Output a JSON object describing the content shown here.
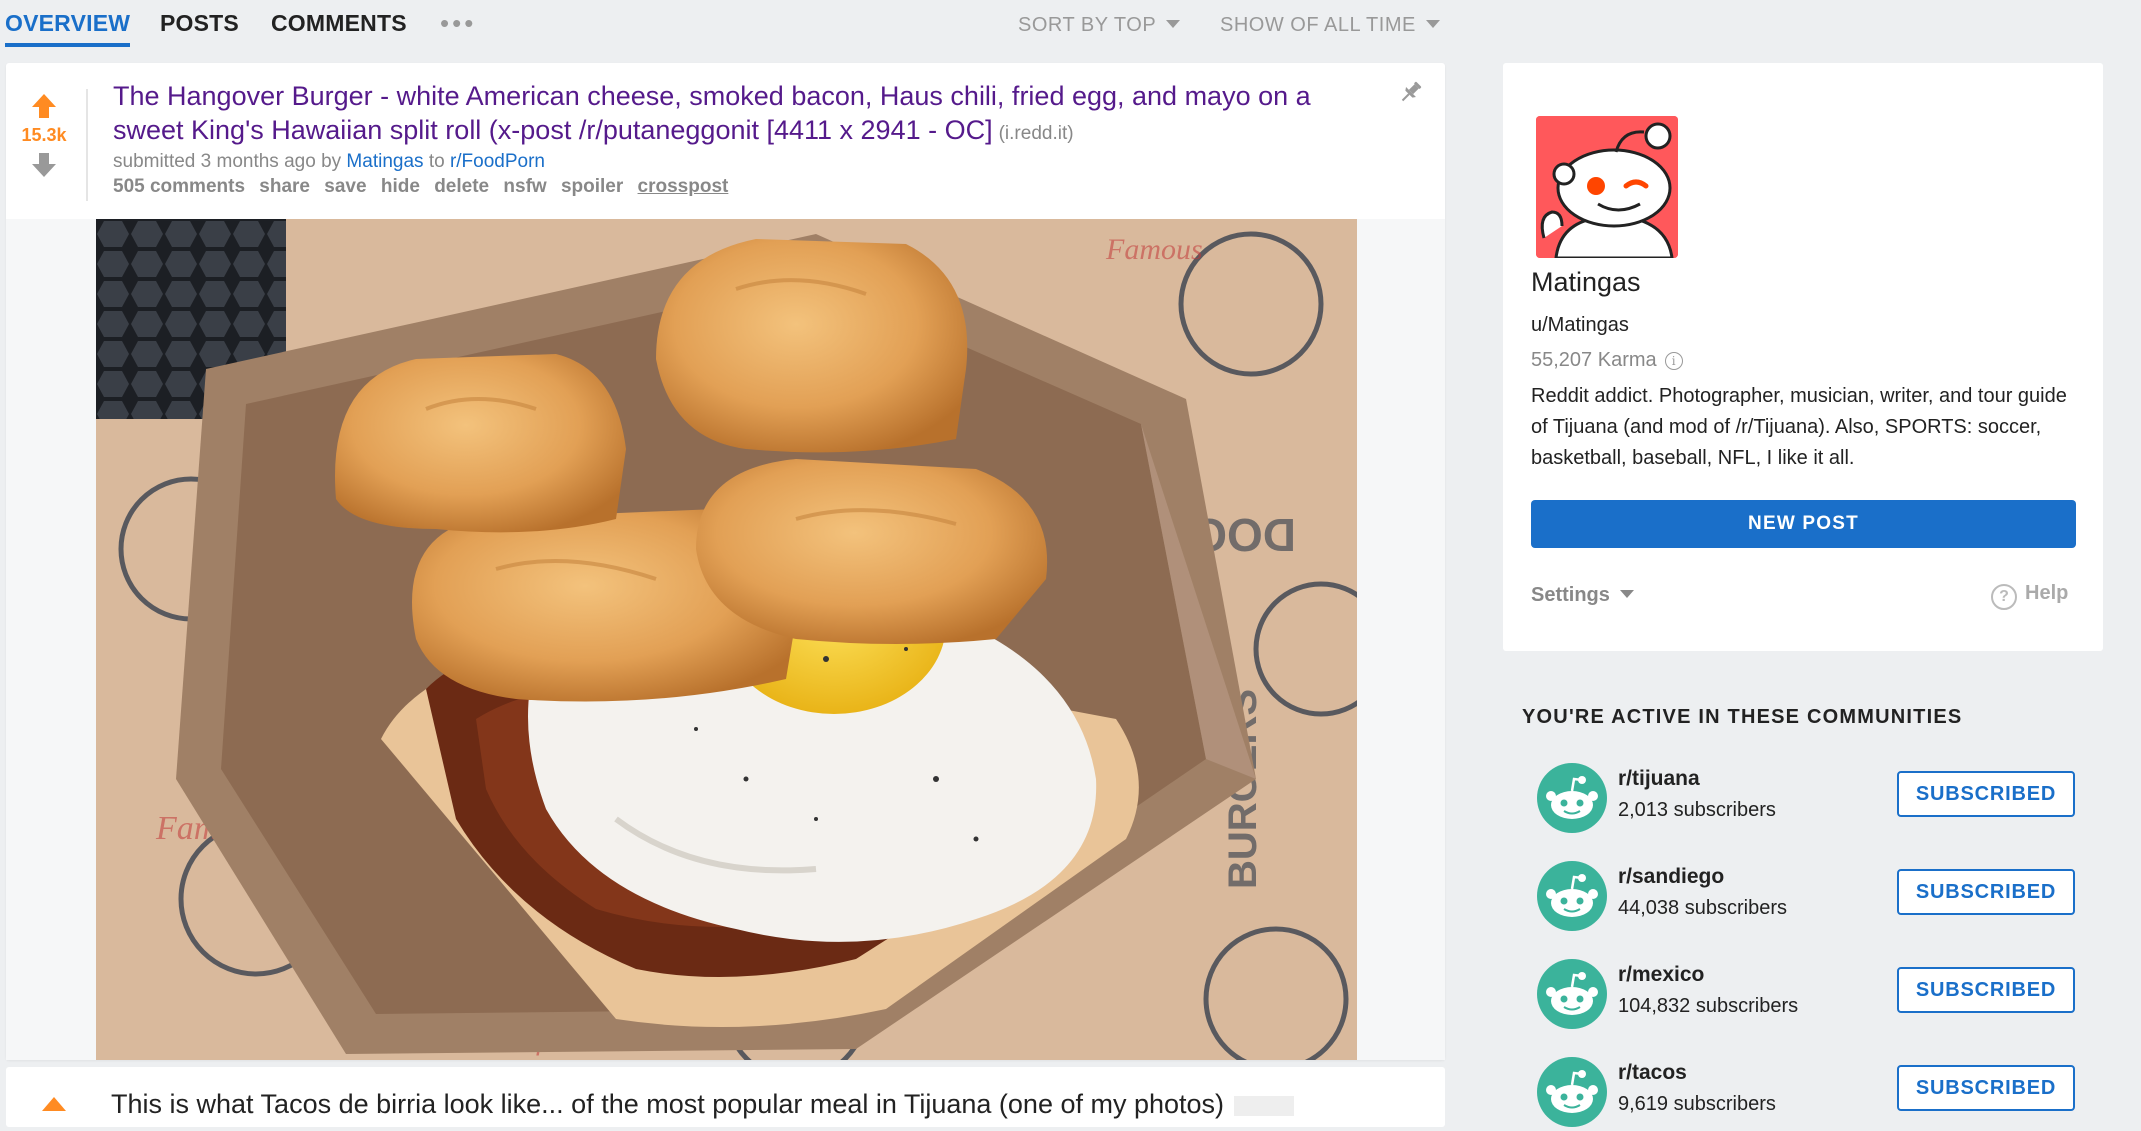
{
  "tabs": [
    {
      "label": "OVERVIEW",
      "active": true
    },
    {
      "label": "POSTS",
      "active": false
    },
    {
      "label": "COMMENTS",
      "active": false
    }
  ],
  "more_label": "•••",
  "sort": {
    "label": "SORT BY TOP"
  },
  "time_filter": {
    "label": "SHOW OF ALL TIME"
  },
  "post": {
    "score": "15.3k",
    "title": "The Hangover Burger - white American cheese, smoked bacon, Haus chili, fried egg, and mayo on a sweet King's Hawaiian split roll (x-post /r/putaneggonit [4411 x 2941 - OC]",
    "domain": "(i.redd.it)",
    "submitted_prefix": "submitted 3 months ago by",
    "author": "Matingas",
    "to_word": "to",
    "subreddit": "r/FoodPorn",
    "actions": {
      "comments": "505 comments",
      "share": "share",
      "save": "save",
      "hide": "hide",
      "delete": "delete",
      "nsfw": "nsfw",
      "spoiler": "spoiler",
      "crosspost": "crosspost"
    }
  },
  "next_post": {
    "title_partial": "This is what Tacos de birria look like... of the most popular meal in Tijuana (one of my photos)"
  },
  "profile": {
    "display_name": "Matingas",
    "username": "u/Matingas",
    "karma": "55,207 Karma",
    "bio": "Reddit addict. Photographer, musician, writer, and tour guide of Tijuana (and mod of /r/Tijuana). Also, SPORTS: soccer, basketball, baseball, NFL, I like it all.",
    "new_post_label": "NEW POST",
    "settings_label": "Settings",
    "help_label": "Help"
  },
  "communities": {
    "heading": "YOU'RE ACTIVE IN THESE COMMUNITIES",
    "items": [
      {
        "name": "r/tijuana",
        "subscribers": "2,013 subscribers",
        "button": "SUBSCRIBED"
      },
      {
        "name": "r/sandiego",
        "subscribers": "44,038 subscribers",
        "button": "SUBSCRIBED"
      },
      {
        "name": "r/mexico",
        "subscribers": "104,832 subscribers",
        "button": "SUBSCRIBED"
      },
      {
        "name": "r/tacos",
        "subscribers": "9,619 subscribers",
        "button": "SUBSCRIBED"
      }
    ]
  },
  "colors": {
    "accent": "#1a6fc9",
    "upvote": "#ff8b22",
    "visited_title": "#551a8b",
    "community_icon": "#3bb39b",
    "avatar_bg": "#ff585b"
  },
  "icons": [
    "upvote-arrow-icon",
    "downvote-arrow-icon",
    "pin-icon",
    "info-icon",
    "help-icon",
    "snoo-avatar-icon",
    "snoo-community-icon"
  ]
}
